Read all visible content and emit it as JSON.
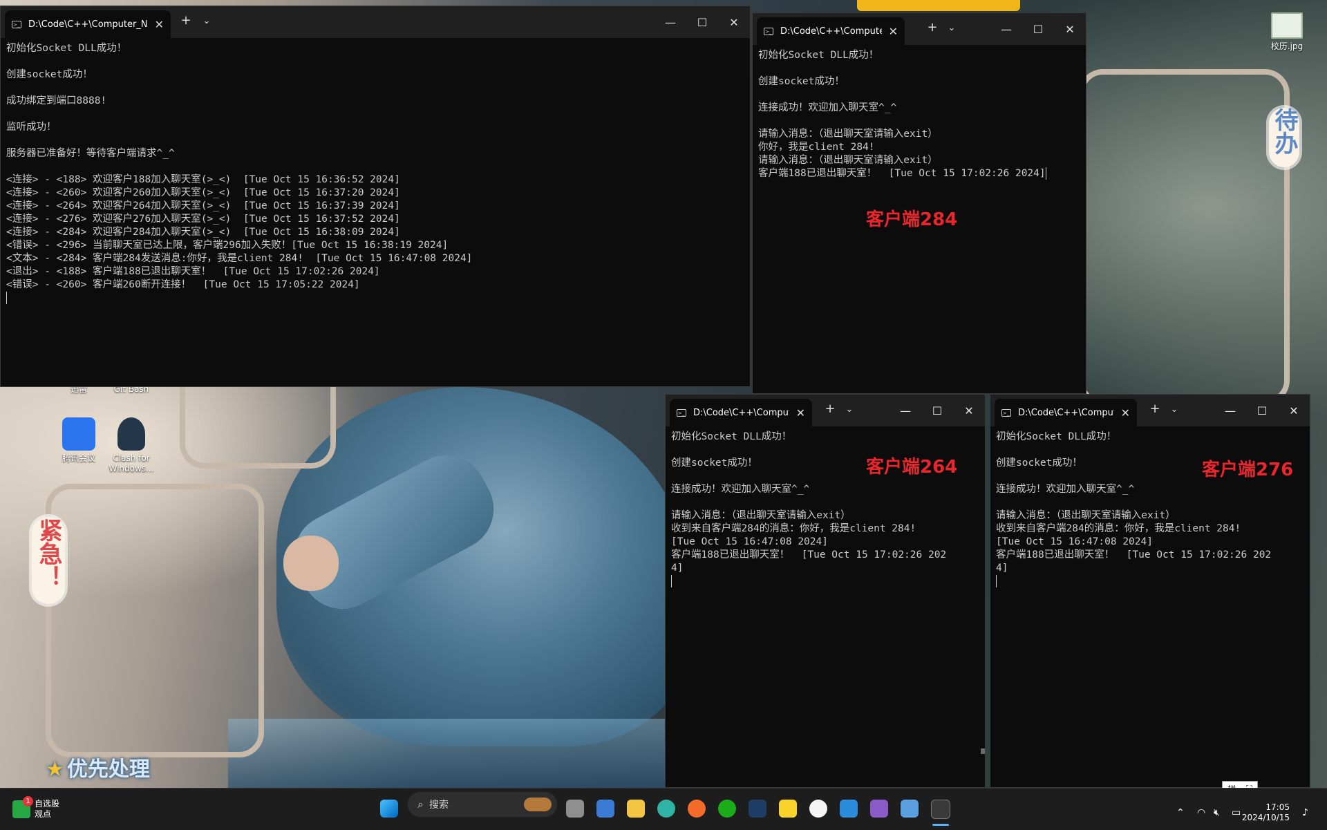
{
  "desktop": {
    "sticker_urgent": "紧急！",
    "sticker_todo": "待办",
    "priority_text": "优先处理",
    "icons": [
      {
        "label": "腾讯会议"
      },
      {
        "label": "Clash for Windows..."
      },
      {
        "label": "校历.jpg"
      }
    ],
    "partial_labels": [
      "迅雷",
      "Git Bash"
    ]
  },
  "windows": {
    "server": {
      "tab_title": "D:\\Code\\C++\\Computer_Netw",
      "lines": [
        "初始化Socket DLL成功！",
        "",
        "创建socket成功！",
        "",
        "成功绑定到端口8888!",
        "",
        "监听成功！",
        "",
        "服务器已准备好！等待客户端请求^_^",
        "",
        "<连接> - <188> 欢迎客户188加入聊天室(>_<)  [Tue Oct 15 16:36:52 2024]",
        "<连接> - <260> 欢迎客户260加入聊天室(>_<)  [Tue Oct 15 16:37:20 2024]",
        "<连接> - <264> 欢迎客户264加入聊天室(>_<)  [Tue Oct 15 16:37:39 2024]",
        "<连接> - <276> 欢迎客户276加入聊天室(>_<)  [Tue Oct 15 16:37:52 2024]",
        "<连接> - <284> 欢迎客户284加入聊天室(>_<)  [Tue Oct 15 16:38:09 2024]",
        "<错误> - <296> 当前聊天室已达上限，客户端296加入失败！[Tue Oct 15 16:38:19 2024]",
        "<文本> - <284> 客户端284发送消息:你好，我是client 284!  [Tue Oct 15 16:47:08 2024]",
        "<退出> - <188> 客户端188已退出聊天室！  [Tue Oct 15 17:02:26 2024]",
        "<错误> - <260> 客户端260断开连接！  [Tue Oct 15 17:05:22 2024]"
      ]
    },
    "client284": {
      "tab_title": "D:\\Code\\C++\\Computer_N",
      "label": "客户端284",
      "lines": [
        "初始化Socket DLL成功！",
        "",
        "创建socket成功！",
        "",
        "连接成功！欢迎加入聊天室^_^",
        "",
        "请输入消息：（退出聊天室请输入exit）",
        "你好，我是client 284!",
        "请输入消息：（退出聊天室请输入exit）",
        "客户端188已退出聊天室！  [Tue Oct 15 17:02:26 2024]"
      ]
    },
    "client264": {
      "tab_title": "D:\\Code\\C++\\Compute",
      "label": "客户端264",
      "lines": [
        "初始化Socket DLL成功！",
        "",
        "创建socket成功！",
        "",
        "连接成功！欢迎加入聊天室^_^",
        "",
        "请输入消息：（退出聊天室请输入exit）",
        "收到来自客户端284的消息：你好，我是client 284!",
        "[Tue Oct 15 16:47:08 2024]",
        "客户端188已退出聊天室！  [Tue Oct 15 17:02:26 202",
        "4]"
      ]
    },
    "client276": {
      "tab_title": "D:\\Code\\C++\\Compute",
      "label": "客户端276",
      "lines": [
        "初始化Socket DLL成功！",
        "",
        "创建socket成功！",
        "",
        "连接成功！欢迎加入聊天室^_^",
        "",
        "请输入消息：（退出聊天室请输入exit）",
        "收到来自客户端284的消息：你好，我是client 284!",
        "[Tue Oct 15 16:47:08 2024]",
        "客户端188已退出聊天室！  [Tue Oct 15 17:02:26 202",
        "4]"
      ]
    }
  },
  "taskbar": {
    "weather_badge": "1",
    "weather_title": "自选股",
    "weather_sub": "观点",
    "search_placeholder": "搜索",
    "time": "17:05",
    "date": "2024/10/15",
    "ime_label": "拼"
  },
  "colors": {
    "terminal_bg": "#0c0c0c",
    "terminal_text": "#cccccc",
    "label_red": "#e8262b",
    "taskbar_bg": "#1d1d1d"
  }
}
